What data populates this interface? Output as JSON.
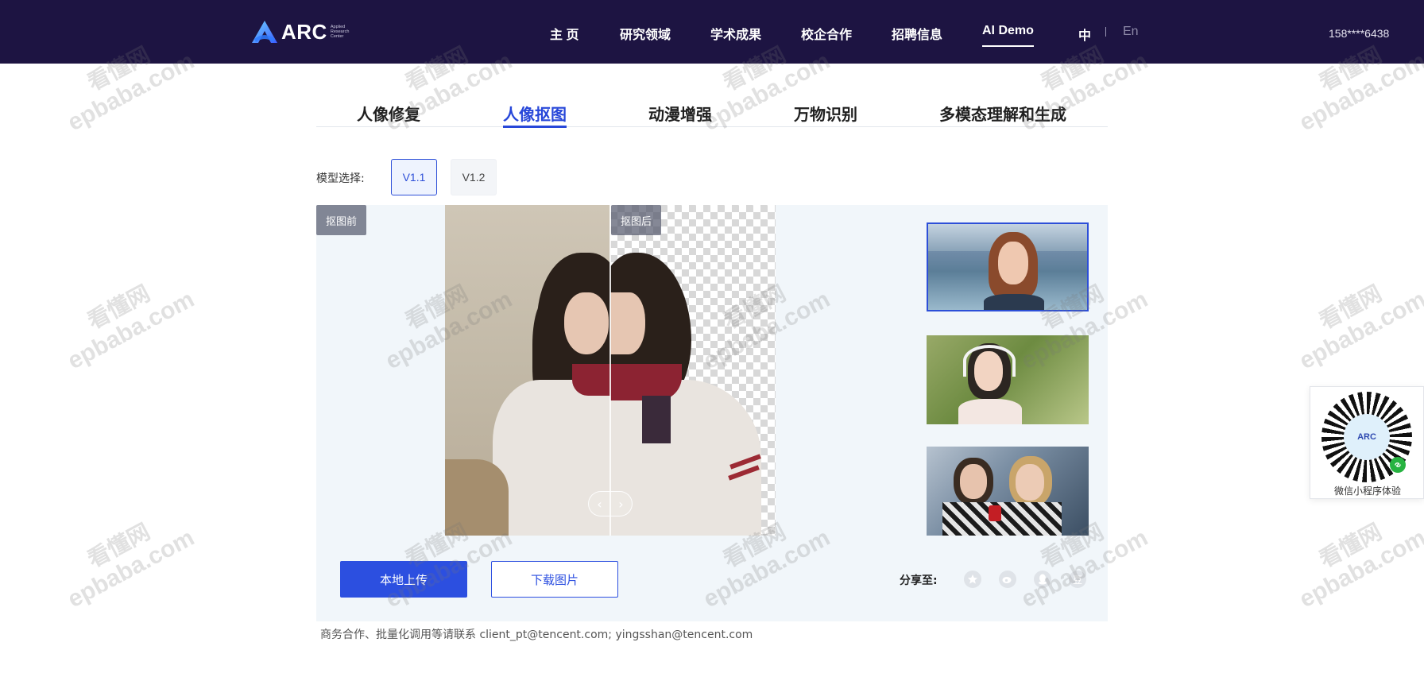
{
  "nav": {
    "logo_text": "ARC",
    "logo_sub": "Applied Research Center",
    "items": [
      {
        "label": "主 页"
      },
      {
        "label": "研究领域"
      },
      {
        "label": "学术成果"
      },
      {
        "label": "校企合作"
      },
      {
        "label": "招聘信息"
      },
      {
        "label": "AI Demo",
        "active": true
      }
    ],
    "lang_zh": "中",
    "lang_en": "En",
    "phone": "158****6438"
  },
  "tabs": [
    {
      "label": "人像修复"
    },
    {
      "label": "人像抠图",
      "active": true
    },
    {
      "label": "动漫增强"
    },
    {
      "label": "万物识别"
    },
    {
      "label": "多模态理解和生成"
    }
  ],
  "model": {
    "label": "模型选择:",
    "options": [
      "V1.1",
      "V1.2"
    ],
    "selected": "V1.1"
  },
  "stage": {
    "before_label": "抠图前",
    "after_label": "抠图后",
    "handle_left": "‹",
    "handle_right": "›",
    "upload_label": "本地上传",
    "download_label": "下载图片",
    "share_label": "分享至:",
    "share_icons": [
      "qzone-icon",
      "weibo-icon",
      "qq-icon",
      "douban-icon"
    ],
    "douban_glyph": "豆"
  },
  "contact": "商务合作、批量化调用等请联系 client_pt@tencent.com; yingsshan@tencent.com",
  "qr": {
    "center_text": "ARC",
    "label": "微信小程序体验"
  },
  "watermark": {
    "cn": "看懂网",
    "en": "epbaba.com"
  },
  "colors": {
    "nav_bg": "#1d1442",
    "accent": "#2c4fe0",
    "stage_bg": "#f1f6fa"
  }
}
